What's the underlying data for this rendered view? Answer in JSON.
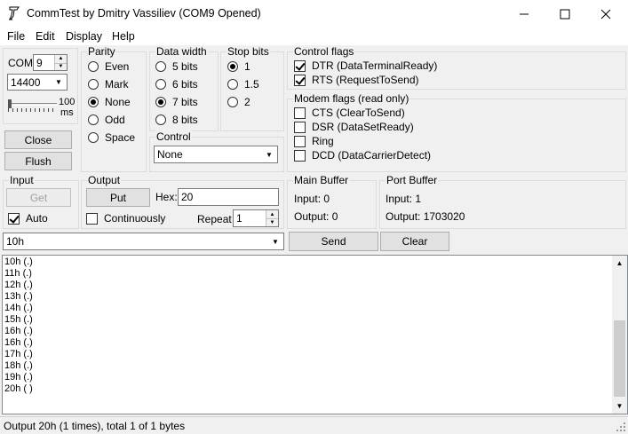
{
  "window": {
    "title": "CommTest by Dmitry Vassiliev (COM9 Opened)"
  },
  "menu": [
    "File",
    "Edit",
    "Display",
    "Help"
  ],
  "port": {
    "com_label": "COM",
    "com_value": "9",
    "baud_value": "14400",
    "slider_label": "100",
    "slider_unit": "ms"
  },
  "buttons": {
    "close": "Close",
    "flush": "Flush",
    "get": "Get",
    "put": "Put",
    "send": "Send",
    "clear": "Clear"
  },
  "parity": {
    "label": "Parity",
    "options": [
      "Even",
      "Mark",
      "None",
      "Odd",
      "Space"
    ],
    "selected": "None"
  },
  "data_width": {
    "label": "Data width",
    "options": [
      "5 bits",
      "6 bits",
      "7 bits",
      "8 bits"
    ],
    "selected": "7 bits"
  },
  "stop_bits": {
    "label": "Stop bits",
    "options": [
      "1",
      "1.5",
      "2"
    ],
    "selected": "1"
  },
  "control_flags": {
    "label": "Control flags",
    "items": [
      {
        "label": "DTR (DataTerminalReady)",
        "checked": true
      },
      {
        "label": "RTS (RequestToSend)",
        "checked": true
      }
    ]
  },
  "modem_flags": {
    "label": "Modem flags (read only)",
    "items": [
      {
        "label": "CTS (ClearToSend)",
        "checked": false
      },
      {
        "label": "DSR (DataSetReady)",
        "checked": false
      },
      {
        "label": "Ring",
        "checked": false
      },
      {
        "label": "DCD (DataCarrierDetect)",
        "checked": false
      }
    ]
  },
  "control": {
    "label": "Control",
    "value": "None"
  },
  "input_group": {
    "label": "Input",
    "auto_label": "Auto",
    "auto_checked": true
  },
  "output_group": {
    "label": "Output",
    "hex_label": "Hex:",
    "hex_value": "20",
    "continuously_label": "Continuously",
    "continuously_checked": false,
    "repeat_label": "Repeat",
    "repeat_value": "1"
  },
  "main_buffer": {
    "label": "Main Buffer",
    "input": "Input: 0",
    "output": "Output: 0"
  },
  "port_buffer": {
    "label": "Port Buffer",
    "input": "Input: 1",
    "output": "Output: 1703020"
  },
  "send_combo": {
    "value": "10h"
  },
  "output_lines": [
    "10h (.)",
    "11h (.)",
    "12h (.)",
    "13h (.)",
    "14h (.)",
    "15h (.)",
    "16h (.)",
    "16h (.)",
    "17h (.)",
    "18h (.)",
    "19h (.)",
    "20h ( )"
  ],
  "status": "Output 20h (1 times), total 1 of 1 bytes"
}
